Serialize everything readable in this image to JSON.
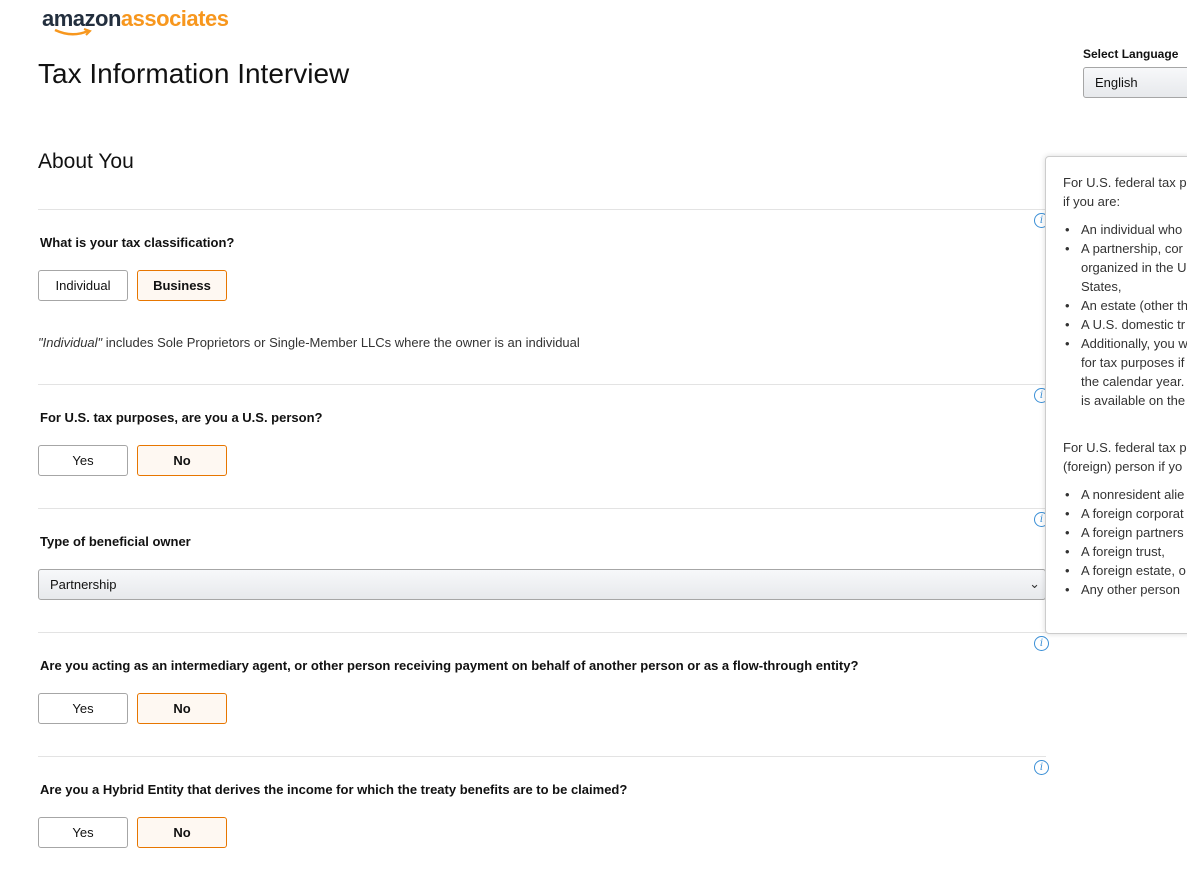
{
  "logo": {
    "part1": "amazon",
    "part2": "associates"
  },
  "page_title": "Tax Information Interview",
  "language": {
    "label": "Select Language",
    "value": "English"
  },
  "section_title": "About You",
  "q_classification": {
    "question": "What is your tax classification?",
    "options": [
      "Individual",
      "Business"
    ],
    "selected": "Business",
    "note_italic": "\"Individual\"",
    "note_rest": " includes Sole Proprietors or Single-Member LLCs where the owner is an individual"
  },
  "q_us_person": {
    "question": "For U.S. tax purposes, are you a U.S. person?",
    "options": [
      "Yes",
      "No"
    ],
    "selected": "No"
  },
  "q_beneficial_owner": {
    "question": "Type of beneficial owner",
    "value": "Partnership"
  },
  "q_intermediary": {
    "question": "Are you acting as an intermediary agent, or other person receiving payment on behalf of another person or as a flow-through entity?",
    "options": [
      "Yes",
      "No"
    ],
    "selected": "No"
  },
  "q_hybrid": {
    "question": "Are you a Hybrid Entity that derives the income for which the treaty benefits are to be claimed?",
    "options": [
      "Yes",
      "No"
    ],
    "selected": "No"
  },
  "popover": {
    "intro1_line1": "For U.S. federal tax p",
    "intro1_line2": "if you are:",
    "us_items": [
      "An individual who",
      "A partnership, cor",
      "organized in the U",
      "States,",
      "An estate (other th",
      "A U.S. domestic tr",
      "Additionally, you w",
      "for tax purposes if",
      "the calendar year.",
      "is available on the"
    ],
    "intro2_line1": "For U.S. federal tax p",
    "intro2_line2": "(foreign) person if yo",
    "foreign_items": [
      "A nonresident alie",
      "A foreign corporat",
      "A foreign partners",
      "A foreign trust,",
      "A foreign estate, o",
      "Any other person"
    ]
  },
  "icons": {
    "info": "info-icon",
    "dropdown": "chevron-down-icon",
    "logo_smile": "amazon-smile-arrow"
  },
  "colors": {
    "accent": "#e77600",
    "selected_bg": "#fef8f2",
    "logo_orange": "#f7971e",
    "info_blue": "#3a8fd6"
  }
}
